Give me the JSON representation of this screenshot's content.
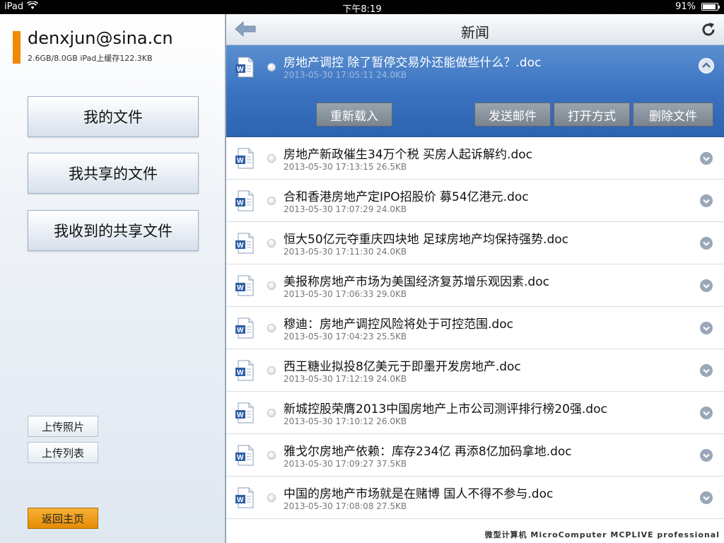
{
  "status_bar": {
    "device": "iPad",
    "time": "下午8:19",
    "battery": "91%",
    "battery_level": 0.91
  },
  "account": {
    "email": "denxjun@sina.cn",
    "usage": "2.6GB/8.0GB  iPad上缓存122.3KB"
  },
  "sidebar": {
    "nav": [
      "我的文件",
      "我共享的文件",
      "我收到的共享文件"
    ],
    "upload_photos": "上传照片",
    "upload_list": "上传列表",
    "home": "返回主页"
  },
  "header": {
    "title": "新闻"
  },
  "selected_file": {
    "name": "房地产调控 除了暂停交易外还能做些什么？.doc",
    "meta": "2013-05-30 17:05:11  24.0KB",
    "actions": {
      "reload": "重新载入",
      "email": "发送邮件",
      "open_with": "打开方式",
      "delete": "删除文件"
    }
  },
  "files": [
    {
      "name": "房地产新政催生34万个税 买房人起诉解约.doc",
      "meta": "2013-05-30 17:13:15  26.5KB"
    },
    {
      "name": "合和香港房地产定IPO招股价 募54亿港元.doc",
      "meta": "2013-05-30 17:07:29  24.0KB"
    },
    {
      "name": "恒大50亿元夺重庆四块地 足球房地产均保持强势.doc",
      "meta": "2013-05-30 17:11:30  24.0KB"
    },
    {
      "name": "美报称房地产市场为美国经济复苏增乐观因素.doc",
      "meta": "2013-05-30 17:06:33  29.0KB"
    },
    {
      "name": "穆迪：房地产调控风险将处于可控范围.doc",
      "meta": "2013-05-30 17:04:23  25.5KB"
    },
    {
      "name": "西王糖业拟投8亿美元于即墨开发房地产.doc",
      "meta": "2013-05-30 17:12:19  24.0KB"
    },
    {
      "name": "新城控股荣膺2013中国房地产上市公司测评排行榜20强.doc",
      "meta": "2013-05-30 17:10:12  26.0KB"
    },
    {
      "name": "雅戈尔房地产依赖：库存234亿 再添8亿加码拿地.doc",
      "meta": "2013-05-30 17:09:27  37.5KB"
    },
    {
      "name": "中国的房地产市场就是在赌博 国人不得不参与.doc",
      "meta": "2013-05-30 17:08:08  27.5KB"
    }
  ],
  "watermark": "微型计算机 MicroComputer MCPLIVE professional",
  "colors": {
    "accent": "#f08a00",
    "selection": "#3b73c1",
    "action_button": "#8b949d"
  },
  "icons": [
    "wifi-icon",
    "battery-icon",
    "back-arrow-icon",
    "refresh-icon",
    "word-doc-icon",
    "chevron-up-icon",
    "chevron-down-icon"
  ]
}
